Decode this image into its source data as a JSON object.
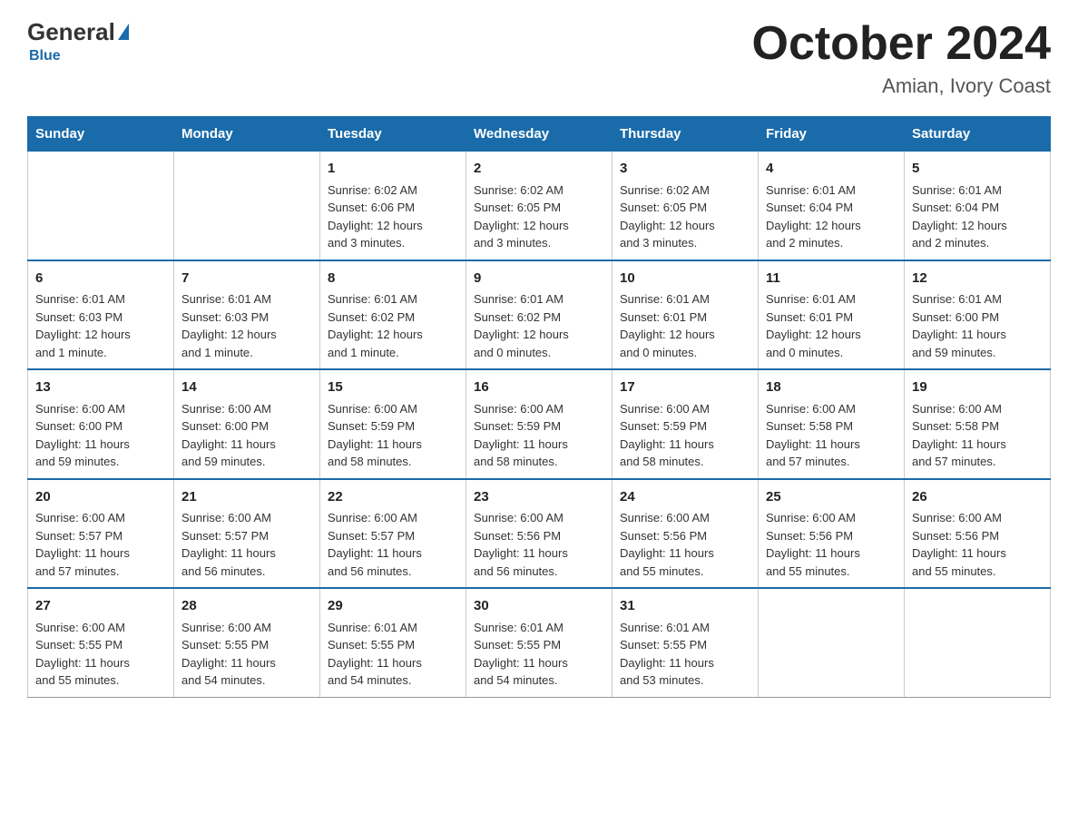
{
  "logo": {
    "general": "General",
    "blue": "Blue",
    "subtitle": "Blue"
  },
  "title": {
    "month": "October 2024",
    "location": "Amian, Ivory Coast"
  },
  "weekdays": [
    "Sunday",
    "Monday",
    "Tuesday",
    "Wednesday",
    "Thursday",
    "Friday",
    "Saturday"
  ],
  "weeks": [
    [
      {
        "day": "",
        "info": ""
      },
      {
        "day": "",
        "info": ""
      },
      {
        "day": "1",
        "info": "Sunrise: 6:02 AM\nSunset: 6:06 PM\nDaylight: 12 hours\nand 3 minutes."
      },
      {
        "day": "2",
        "info": "Sunrise: 6:02 AM\nSunset: 6:05 PM\nDaylight: 12 hours\nand 3 minutes."
      },
      {
        "day": "3",
        "info": "Sunrise: 6:02 AM\nSunset: 6:05 PM\nDaylight: 12 hours\nand 3 minutes."
      },
      {
        "day": "4",
        "info": "Sunrise: 6:01 AM\nSunset: 6:04 PM\nDaylight: 12 hours\nand 2 minutes."
      },
      {
        "day": "5",
        "info": "Sunrise: 6:01 AM\nSunset: 6:04 PM\nDaylight: 12 hours\nand 2 minutes."
      }
    ],
    [
      {
        "day": "6",
        "info": "Sunrise: 6:01 AM\nSunset: 6:03 PM\nDaylight: 12 hours\nand 1 minute."
      },
      {
        "day": "7",
        "info": "Sunrise: 6:01 AM\nSunset: 6:03 PM\nDaylight: 12 hours\nand 1 minute."
      },
      {
        "day": "8",
        "info": "Sunrise: 6:01 AM\nSunset: 6:02 PM\nDaylight: 12 hours\nand 1 minute."
      },
      {
        "day": "9",
        "info": "Sunrise: 6:01 AM\nSunset: 6:02 PM\nDaylight: 12 hours\nand 0 minutes."
      },
      {
        "day": "10",
        "info": "Sunrise: 6:01 AM\nSunset: 6:01 PM\nDaylight: 12 hours\nand 0 minutes."
      },
      {
        "day": "11",
        "info": "Sunrise: 6:01 AM\nSunset: 6:01 PM\nDaylight: 12 hours\nand 0 minutes."
      },
      {
        "day": "12",
        "info": "Sunrise: 6:01 AM\nSunset: 6:00 PM\nDaylight: 11 hours\nand 59 minutes."
      }
    ],
    [
      {
        "day": "13",
        "info": "Sunrise: 6:00 AM\nSunset: 6:00 PM\nDaylight: 11 hours\nand 59 minutes."
      },
      {
        "day": "14",
        "info": "Sunrise: 6:00 AM\nSunset: 6:00 PM\nDaylight: 11 hours\nand 59 minutes."
      },
      {
        "day": "15",
        "info": "Sunrise: 6:00 AM\nSunset: 5:59 PM\nDaylight: 11 hours\nand 58 minutes."
      },
      {
        "day": "16",
        "info": "Sunrise: 6:00 AM\nSunset: 5:59 PM\nDaylight: 11 hours\nand 58 minutes."
      },
      {
        "day": "17",
        "info": "Sunrise: 6:00 AM\nSunset: 5:59 PM\nDaylight: 11 hours\nand 58 minutes."
      },
      {
        "day": "18",
        "info": "Sunrise: 6:00 AM\nSunset: 5:58 PM\nDaylight: 11 hours\nand 57 minutes."
      },
      {
        "day": "19",
        "info": "Sunrise: 6:00 AM\nSunset: 5:58 PM\nDaylight: 11 hours\nand 57 minutes."
      }
    ],
    [
      {
        "day": "20",
        "info": "Sunrise: 6:00 AM\nSunset: 5:57 PM\nDaylight: 11 hours\nand 57 minutes."
      },
      {
        "day": "21",
        "info": "Sunrise: 6:00 AM\nSunset: 5:57 PM\nDaylight: 11 hours\nand 56 minutes."
      },
      {
        "day": "22",
        "info": "Sunrise: 6:00 AM\nSunset: 5:57 PM\nDaylight: 11 hours\nand 56 minutes."
      },
      {
        "day": "23",
        "info": "Sunrise: 6:00 AM\nSunset: 5:56 PM\nDaylight: 11 hours\nand 56 minutes."
      },
      {
        "day": "24",
        "info": "Sunrise: 6:00 AM\nSunset: 5:56 PM\nDaylight: 11 hours\nand 55 minutes."
      },
      {
        "day": "25",
        "info": "Sunrise: 6:00 AM\nSunset: 5:56 PM\nDaylight: 11 hours\nand 55 minutes."
      },
      {
        "day": "26",
        "info": "Sunrise: 6:00 AM\nSunset: 5:56 PM\nDaylight: 11 hours\nand 55 minutes."
      }
    ],
    [
      {
        "day": "27",
        "info": "Sunrise: 6:00 AM\nSunset: 5:55 PM\nDaylight: 11 hours\nand 55 minutes."
      },
      {
        "day": "28",
        "info": "Sunrise: 6:00 AM\nSunset: 5:55 PM\nDaylight: 11 hours\nand 54 minutes."
      },
      {
        "day": "29",
        "info": "Sunrise: 6:01 AM\nSunset: 5:55 PM\nDaylight: 11 hours\nand 54 minutes."
      },
      {
        "day": "30",
        "info": "Sunrise: 6:01 AM\nSunset: 5:55 PM\nDaylight: 11 hours\nand 54 minutes."
      },
      {
        "day": "31",
        "info": "Sunrise: 6:01 AM\nSunset: 5:55 PM\nDaylight: 11 hours\nand 53 minutes."
      },
      {
        "day": "",
        "info": ""
      },
      {
        "day": "",
        "info": ""
      }
    ]
  ]
}
